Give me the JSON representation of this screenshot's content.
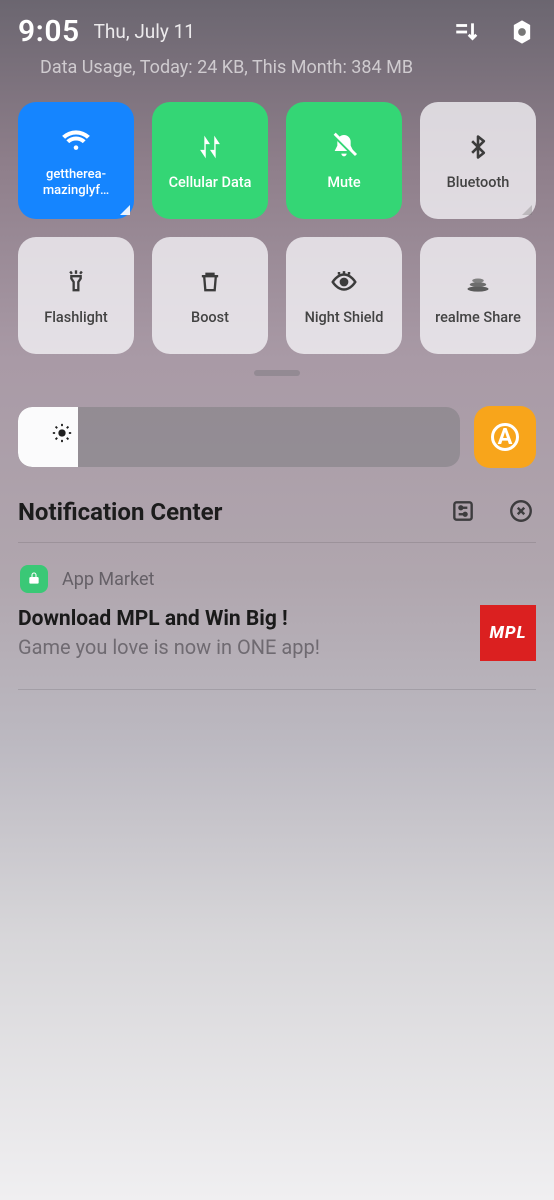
{
  "header": {
    "time": "9:05",
    "date": "Thu, July 11",
    "data_usage": "Data Usage, Today: 24 KB, This Month: 384 MB"
  },
  "tiles": {
    "wifi": "gettherea-mazinglyf…",
    "cellular": "Cellular Data",
    "mute": "Mute",
    "bluetooth": "Bluetooth",
    "flashlight": "Flashlight",
    "boost": "Boost",
    "nightshield": "Night Shield",
    "realmeshare": "realme Share"
  },
  "brightness": {
    "auto_badge": "A"
  },
  "notification_center": {
    "title": "Notification Center"
  },
  "notification": {
    "app_name": "App Market",
    "title": "Download MPL and Win Big !",
    "subtitle": "Game you love is now in ONE app!",
    "thumb_text": "MPL"
  },
  "colors": {
    "accent_blue": "#1585ff",
    "accent_green": "#34d675",
    "accent_orange": "#f8a51b",
    "brand_red": "#db2020"
  }
}
